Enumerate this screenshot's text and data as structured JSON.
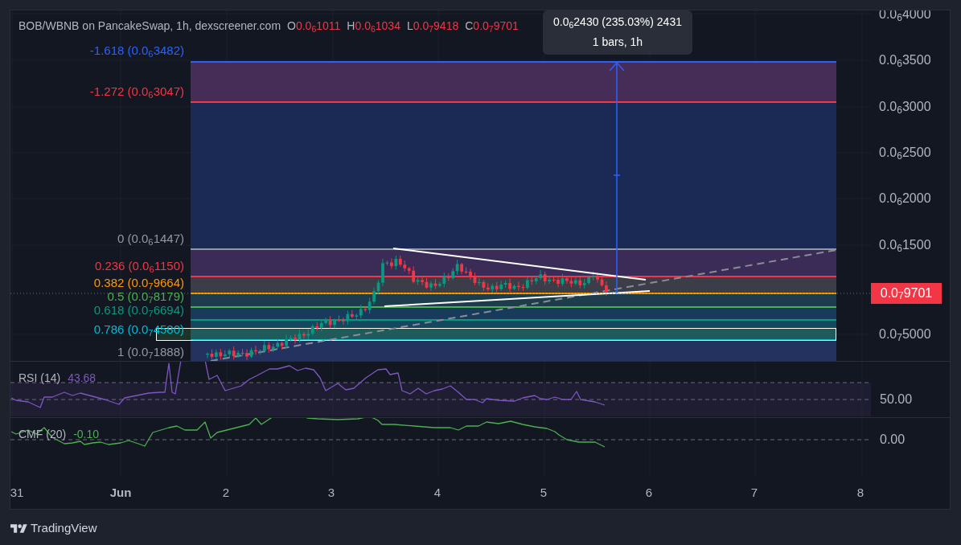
{
  "header": {
    "title": "BOB/WBNB on PancakeSwap, 1h, dexscreener.com",
    "ohlc": [
      {
        "label": "O",
        "value": "0.0$_{6}$1011"
      },
      {
        "label": "H",
        "value": "0.0$_{6}$1034"
      },
      {
        "label": "L",
        "value": "0.0$_{7}$9418"
      },
      {
        "label": "C",
        "value": "0.0$_{7}$9701"
      }
    ]
  },
  "measure_tooltip": {
    "change": "0.0$_{6}$2430 (235.03%) 2431",
    "bars": "1 bars, 1h"
  },
  "fib_levels": [
    {
      "label": "-1.618 (0.0$_{6}$3482)",
      "color": "#2962ff"
    },
    {
      "label": "-1.272 (0.0$_{6}$3047)",
      "color": "#f23645"
    },
    {
      "label": "0 (0.0$_{6}$1447)",
      "color": "#9598a1"
    },
    {
      "label": "0.236 (0.0$_{6}$1150)",
      "color": "#f23645"
    },
    {
      "label": "0.382 (0.0$_{7}$9664)",
      "color": "#ff9800"
    },
    {
      "label": "0.5 (0.0$_{7}$8179)",
      "color": "#4caf50"
    },
    {
      "label": "0.618 (0.0$_{7}$6694)",
      "color": "#089981"
    },
    {
      "label": "0.786 (0.0$_{7}$4580)",
      "color": "#00bcd4"
    },
    {
      "label": "1 (0.0$_{7}$1888)",
      "color": "#9598a1"
    }
  ],
  "price_axis": {
    "ticks": [
      "0.0$_{6}$4000",
      "0.0$_{6}$3500",
      "0.0$_{6}$3000",
      "0.0$_{6}$2500",
      "0.0$_{6}$2000",
      "0.0$_{6}$1500",
      "0.0$_{7}$5000"
    ],
    "last_price": "0.0$_{7}$9701"
  },
  "indicators": [
    {
      "kind": "rsi",
      "name": "RSI (14)",
      "value": "43.68",
      "color": "#7e57c2",
      "axis_label": "50.00"
    },
    {
      "kind": "cmf",
      "name": "CMF (20)",
      "value": "-0.10",
      "color": "#4caf50",
      "axis_label": "0.00"
    }
  ],
  "time_axis": [
    {
      "label": "31",
      "kind": "day"
    },
    {
      "label": "Jun",
      "kind": "month"
    },
    {
      "label": "2",
      "kind": "day"
    },
    {
      "label": "3",
      "kind": "day"
    },
    {
      "label": "4",
      "kind": "day"
    },
    {
      "label": "5",
      "kind": "day"
    },
    {
      "label": "6",
      "kind": "day"
    },
    {
      "label": "7",
      "kind": "day"
    },
    {
      "label": "8",
      "kind": "day"
    }
  ],
  "footer": {
    "logo": "TradingView"
  }
}
